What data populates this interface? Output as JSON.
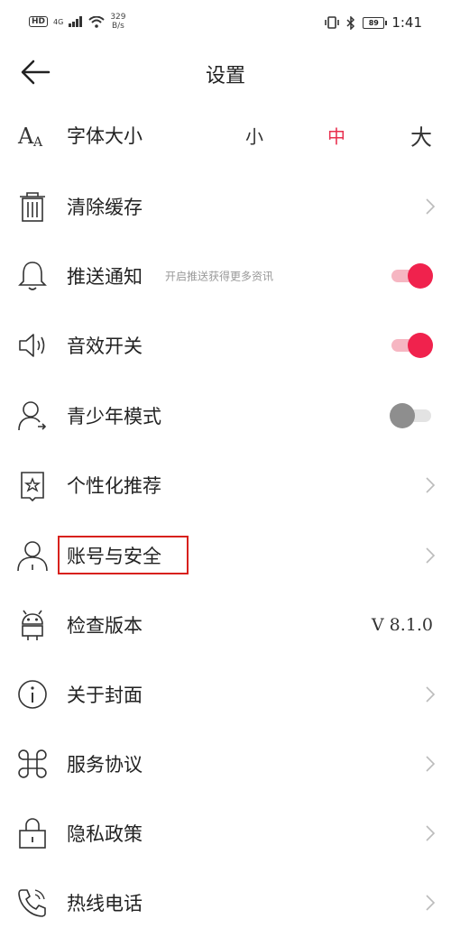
{
  "status_bar": {
    "left_badge": "HD",
    "network": "4G",
    "speed_value": "329",
    "speed_unit": "B/s",
    "battery": "89",
    "time": "1:41"
  },
  "header": {
    "title": "设置"
  },
  "font_size": {
    "label": "字体大小",
    "options": [
      "小",
      "中",
      "大"
    ],
    "selected": "中"
  },
  "items": {
    "clear_cache": {
      "label": "清除缓存"
    },
    "push": {
      "label": "推送通知",
      "hint": "开启推送获得更多资讯",
      "on": true
    },
    "sound": {
      "label": "音效开关",
      "on": true
    },
    "teen": {
      "label": "青少年模式",
      "on": false
    },
    "personal": {
      "label": "个性化推荐"
    },
    "account": {
      "label": "账号与安全"
    },
    "version": {
      "label": "检查版本",
      "value": "V 8.1.0"
    },
    "about": {
      "label": "关于封面"
    },
    "service": {
      "label": "服务协议"
    },
    "privacy": {
      "label": "隐私政策"
    },
    "hotline": {
      "label": "热线电话"
    }
  },
  "colors": {
    "accent": "#f0224d",
    "highlight_box": "#d8211d"
  }
}
